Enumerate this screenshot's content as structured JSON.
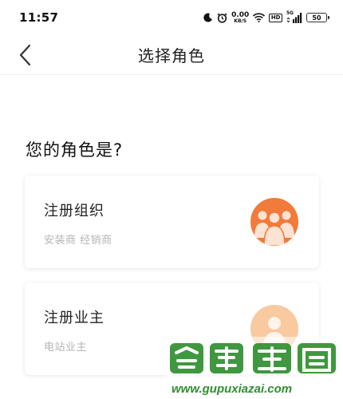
{
  "status": {
    "time": "11:57",
    "net_speed_value": "0.00",
    "net_speed_unit": "KB/S",
    "hd": "HD",
    "signal_label": "5G",
    "battery": "50"
  },
  "nav": {
    "title": "选择角色"
  },
  "question": "您的角色是?",
  "roles": [
    {
      "title": "注册组织",
      "subtitle": "安装商 经销商",
      "icon": "group-icon"
    },
    {
      "title": "注册业主",
      "subtitle": "电站业主",
      "icon": "person-icon"
    }
  ],
  "colors": {
    "org_icon": "#f27a3a",
    "owner_icon": "#f9c9a0"
  }
}
